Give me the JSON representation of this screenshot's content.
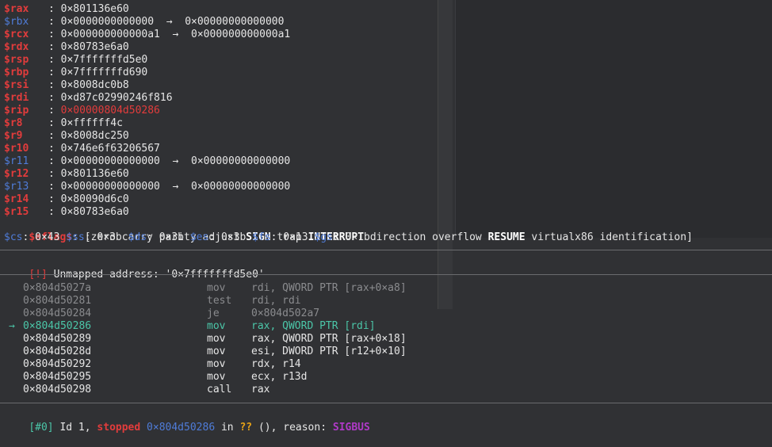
{
  "registers": [
    {
      "name": "$rax",
      "style": "red",
      "value": "0×801136e60"
    },
    {
      "name": "$rbx",
      "style": "blue",
      "value": "0×0000000000000",
      "deref": "0×00000000000000"
    },
    {
      "name": "$rcx",
      "style": "red",
      "value": "0×000000000000a1",
      "deref": "0×000000000000a1"
    },
    {
      "name": "$rdx",
      "style": "red",
      "value": "0×80783e6a0"
    },
    {
      "name": "$rsp",
      "style": "red",
      "value": "0×7fffffffd5e0"
    },
    {
      "name": "$rbp",
      "style": "red",
      "value": "0×7fffffffd690"
    },
    {
      "name": "$rsi",
      "style": "red",
      "value": "0×8008dc0b8"
    },
    {
      "name": "$rdi",
      "style": "red",
      "value": "0×d87c02990246f816"
    },
    {
      "name": "$rip",
      "style": "red",
      "value": "0×00000804d50286",
      "value_style": "red"
    },
    {
      "name": "$r8",
      "style": "red",
      "value": "0×ffffff4c"
    },
    {
      "name": "$r9",
      "style": "red",
      "value": "0×8008dc250"
    },
    {
      "name": "$r10",
      "style": "red",
      "value": "0×746e6f63206567"
    },
    {
      "name": "$r11",
      "style": "blue",
      "value": "0×00000000000000",
      "deref": "0×00000000000000"
    },
    {
      "name": "$r12",
      "style": "red",
      "value": "0×801136e60"
    },
    {
      "name": "$r13",
      "style": "blue",
      "value": "0×00000000000000",
      "deref": "0×00000000000000"
    },
    {
      "name": "$r14",
      "style": "red",
      "value": "0×80090d6c0"
    },
    {
      "name": "$r15",
      "style": "red",
      "value": "0×80783e6a0"
    }
  ],
  "eflags": {
    "name": "$eflags",
    "open": "[",
    "flags": [
      {
        "text": "zero",
        "bold": false
      },
      {
        "text": "carry",
        "bold": false
      },
      {
        "text": "parity",
        "bold": false
      },
      {
        "text": "adjust",
        "bold": false
      },
      {
        "text": "SIGN",
        "bold": true
      },
      {
        "text": "trap",
        "bold": false
      },
      {
        "text": "INTERRUPT",
        "bold": true
      },
      {
        "text": "direction",
        "bold": false
      },
      {
        "text": "overflow",
        "bold": false
      },
      {
        "text": "RESUME",
        "bold": true
      },
      {
        "text": "virtualx86",
        "bold": false
      },
      {
        "text": "identification",
        "bold": false
      }
    ],
    "close": "]"
  },
  "segments": [
    {
      "name": "$cs",
      "value": "0×43"
    },
    {
      "name": "$ss",
      "value": "0×3b"
    },
    {
      "name": "$ds",
      "value": "0×3b"
    },
    {
      "name": "$es",
      "value": "0×3b"
    },
    {
      "name": "$fs",
      "value": "0×13"
    },
    {
      "name": "$gs",
      "value": "0×1b"
    }
  ],
  "error": {
    "tag": "[!]",
    "text": "Unmapped address: '0×7fffffffd5e0'"
  },
  "disassembly": [
    {
      "addr": "0×804d5027a",
      "mnemonic": "mov",
      "operands": "rdi, QWORD PTR [rax+0×a8]",
      "state": "past"
    },
    {
      "addr": "0×804d50281",
      "mnemonic": "test",
      "operands": "rdi, rdi",
      "state": "past"
    },
    {
      "addr": "0×804d50284",
      "mnemonic": "je",
      "operands": "0×804d502a7",
      "state": "past"
    },
    {
      "addr": "0×804d50286",
      "mnemonic": "mov",
      "operands": "rax, QWORD PTR [rdi]",
      "state": "current",
      "marker": "→"
    },
    {
      "addr": "0×804d50289",
      "mnemonic": "mov",
      "operands": "rax, QWORD PTR [rax+0×18]",
      "state": "future"
    },
    {
      "addr": "0×804d5028d",
      "mnemonic": "mov",
      "operands": "esi, DWORD PTR [r12+0×10]",
      "state": "future"
    },
    {
      "addr": "0×804d50292",
      "mnemonic": "mov",
      "operands": "rdx, r14",
      "state": "future"
    },
    {
      "addr": "0×804d50295",
      "mnemonic": "mov",
      "operands": "ecx, r13d",
      "state": "future"
    },
    {
      "addr": "0×804d50298",
      "mnemonic": "call",
      "operands": "rax",
      "state": "future"
    }
  ],
  "thread": {
    "tag": "[#0]",
    "id_text": "Id 1,",
    "status": "stopped",
    "addr": "0×804d50286",
    "in": "in",
    "func": "??",
    "parens": "(),",
    "reason_label": "reason:",
    "reason": "SIGBUS"
  },
  "arrow_glyph": "→",
  "colors": {
    "background": "#303134",
    "reg_red": "#e23c3c",
    "reg_blue": "#4f7cd8",
    "current": "#4bc6a8",
    "dim": "#8a8b8e",
    "warn": "#e8a317",
    "signal": "#b03ac8"
  }
}
